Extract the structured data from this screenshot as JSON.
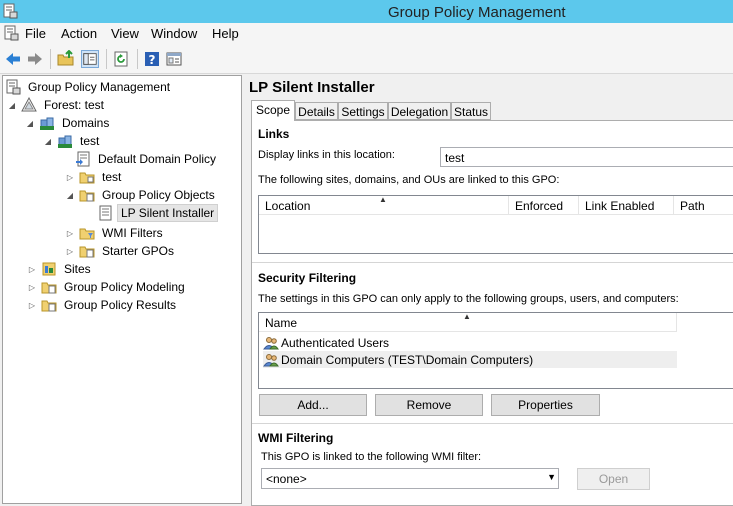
{
  "window": {
    "title": "Group Policy Management"
  },
  "menu": [
    "File",
    "Action",
    "View",
    "Window",
    "Help"
  ],
  "toolbar": [
    "back-icon",
    "forward-icon",
    "up-folder-icon",
    "show-hide-tree-icon",
    "refresh-icon",
    "help-icon",
    "properties-icon"
  ],
  "tree": {
    "root": "Group Policy Management",
    "forest": "Forest: test",
    "domains": "Domains",
    "domain": "test",
    "default_policy": "Default Domain Policy",
    "ou_test": "test",
    "gpo_container": "Group Policy Objects",
    "selected_gpo": "LP Silent Installer",
    "wmi_filters": "WMI Filters",
    "starter_gpos": "Starter GPOs",
    "sites": "Sites",
    "modeling": "Group Policy Modeling",
    "results": "Group Policy Results"
  },
  "gpo": {
    "title": "LP Silent Installer",
    "tabs": [
      "Scope",
      "Details",
      "Settings",
      "Delegation",
      "Status"
    ],
    "active_tab": "Scope"
  },
  "links": {
    "heading": "Links",
    "display_label": "Display links in this location:",
    "display_value": "test",
    "description": "The following sites, domains, and OUs are linked to this GPO:",
    "columns": [
      "Location",
      "Enforced",
      "Link Enabled",
      "Path"
    ]
  },
  "security": {
    "heading": "Security Filtering",
    "description": "The settings in this GPO can only apply to the following groups, users, and computers:",
    "column": "Name",
    "rows": [
      "Authenticated Users",
      "Domain Computers (TEST\\Domain Computers)"
    ],
    "buttons": {
      "add": "Add...",
      "remove": "Remove",
      "properties": "Properties"
    }
  },
  "wmi": {
    "heading": "WMI Filtering",
    "description": "This GPO is linked to the following WMI filter:",
    "filter_value": "<none>",
    "open": "Open"
  }
}
